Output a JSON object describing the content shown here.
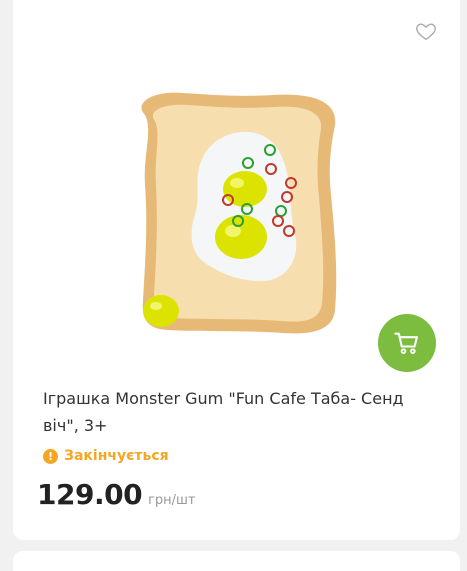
{
  "product": {
    "title": "Іграшка Monster Gum \"Fun Cafe Таба- Сенд віч\", 3+",
    "status": "Закінчується",
    "price": "129.00",
    "unit": "грн/шт",
    "image_alt": "toast-with-eggs-toy"
  },
  "icons": {
    "favorite": "heart-outline-icon",
    "cart": "cart-icon",
    "status": "exclamation-circle-icon"
  },
  "colors": {
    "accent_green": "#7cbc3f",
    "status_orange": "#f5a623",
    "price": "#222222"
  }
}
